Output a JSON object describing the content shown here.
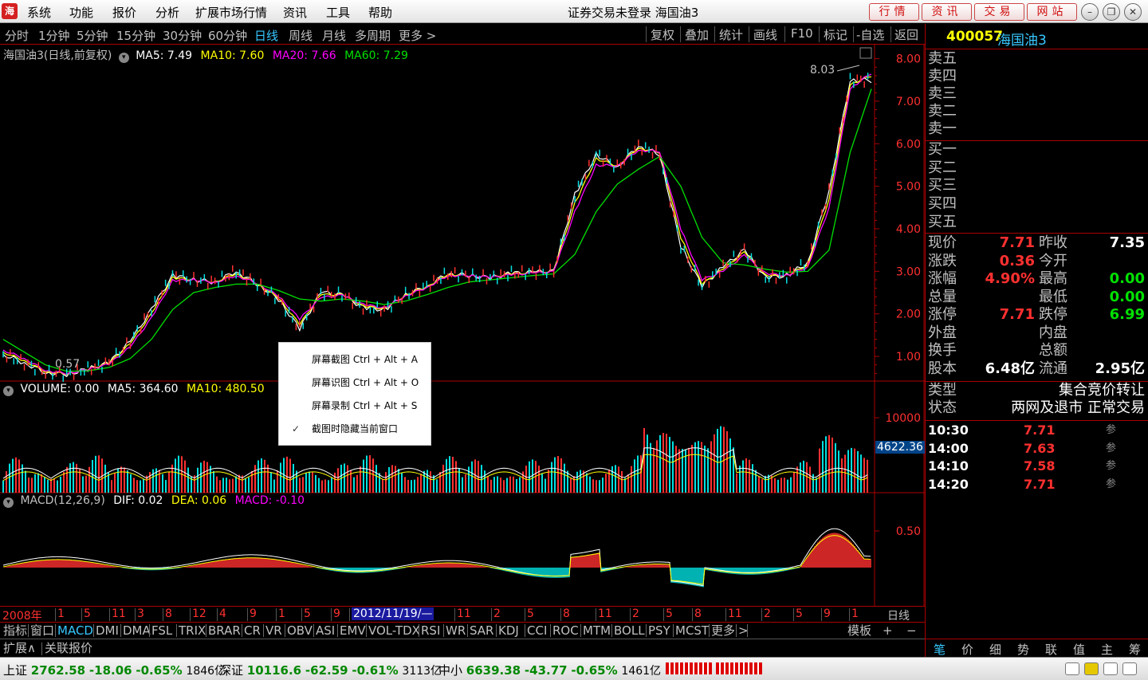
{
  "menubar": {
    "logo": "海",
    "items": [
      "系统",
      "功能",
      "报价",
      "分析",
      "扩展市场行情",
      "资讯",
      "工具",
      "帮助"
    ],
    "title": "证券交易未登录 海国油3",
    "buttons": [
      "行情",
      "资讯",
      "交易",
      "网站"
    ]
  },
  "periods": {
    "items": [
      "分时",
      "1分钟",
      "5分钟",
      "15分钟",
      "30分钟",
      "60分钟",
      "日线",
      "周线",
      "月线",
      "多周期",
      "更多 >"
    ],
    "active": "日线"
  },
  "tools": [
    "复权",
    "叠加",
    "统计",
    "画线",
    "F10",
    "标记",
    "-自选",
    "返回"
  ],
  "stock": {
    "code": "400057",
    "name": "海国油3"
  },
  "main_legend": {
    "title": "海国油3(日线,前复权)",
    "ma5": "MA5: 7.49",
    "ma10": "MA10: 7.60",
    "ma20": "MA20: 7.66",
    "ma60": "MA60: 7.29"
  },
  "vol_legend": {
    "vol": "VOLUME: 0.00",
    "ma5": "MA5: 364.60",
    "ma10": "MA10: 480.50"
  },
  "macd_legend": {
    "name": "MACD(12,26,9)",
    "dif": "DIF: 0.02",
    "dea": "DEA: 0.06",
    "macd": "MACD: -0.10"
  },
  "annotations": {
    "high": "8.03",
    "low": "0.57",
    "vol_tag": "4622.36"
  },
  "colors": {
    "up": "#ff3030",
    "down": "#00e0e0",
    "ma5": "#ffffff",
    "ma10": "#ffff00",
    "ma20": "#ff00ff",
    "ma60": "#00e000",
    "axis": "#ff3030",
    "accent": "#37c8ff"
  },
  "chart_data": [
    {
      "type": "line",
      "title": "海国油3(日线,前复权)",
      "series": [
        {
          "name": "MA5",
          "values": [
            1.05,
            0.85,
            0.62,
            0.58,
            0.7,
            0.85,
            1.35,
            2.1,
            2.9,
            2.8,
            2.75,
            3.0,
            2.7,
            2.35,
            1.65,
            2.5,
            2.45,
            2.15,
            2.1,
            2.45,
            2.65,
            2.95,
            2.9,
            2.85,
            2.95,
            2.98,
            3.0,
            4.8,
            5.75,
            5.45,
            5.95,
            5.75,
            3.6,
            2.65,
            3.1,
            3.5,
            2.85,
            2.9,
            3.2,
            4.9,
            7.5,
            7.49
          ]
        },
        {
          "name": "MA10",
          "values": [
            1.1,
            0.9,
            0.64,
            0.59,
            0.7,
            0.84,
            1.3,
            2.0,
            2.85,
            2.8,
            2.75,
            2.95,
            2.7,
            2.38,
            1.75,
            2.45,
            2.45,
            2.18,
            2.12,
            2.44,
            2.64,
            2.93,
            2.9,
            2.86,
            2.94,
            2.97,
            3.0,
            4.6,
            5.65,
            5.48,
            5.9,
            5.8,
            3.8,
            2.7,
            3.05,
            3.45,
            2.9,
            2.9,
            3.15,
            4.7,
            7.4,
            7.6
          ]
        },
        {
          "name": "MA20",
          "values": [
            1.15,
            0.95,
            0.67,
            0.6,
            0.69,
            0.82,
            1.22,
            1.9,
            2.78,
            2.8,
            2.74,
            2.9,
            2.72,
            2.42,
            1.88,
            2.38,
            2.44,
            2.22,
            2.14,
            2.42,
            2.62,
            2.9,
            2.9,
            2.86,
            2.92,
            2.96,
            2.99,
            4.4,
            5.5,
            5.48,
            5.85,
            5.82,
            4.0,
            2.8,
            3.0,
            3.38,
            2.95,
            2.9,
            3.1,
            4.5,
            7.3,
            7.66
          ]
        },
        {
          "name": "MA60",
          "values": [
            1.4,
            1.1,
            0.8,
            0.65,
            0.66,
            0.74,
            0.95,
            1.4,
            2.1,
            2.5,
            2.62,
            2.7,
            2.7,
            2.55,
            2.35,
            2.3,
            2.35,
            2.3,
            2.22,
            2.3,
            2.45,
            2.62,
            2.75,
            2.8,
            2.85,
            2.9,
            2.94,
            3.4,
            4.4,
            5.05,
            5.4,
            5.7,
            5.0,
            3.8,
            3.2,
            3.15,
            3.05,
            2.98,
            3.0,
            3.5,
            5.8,
            7.29
          ]
        }
      ],
      "ylim": [
        0.57,
        8.03
      ],
      "yticks": [
        "8.00",
        "7.00",
        "6.00",
        "5.00",
        "4.00",
        "3.00",
        "2.00",
        "1.00"
      ]
    },
    {
      "type": "bar",
      "title": "VOLUME",
      "yticks": [
        "10000"
      ],
      "series": [
        {
          "name": "VOLUME",
          "values": [
            0.0
          ]
        },
        {
          "name": "MA5",
          "values": [
            364.6
          ]
        },
        {
          "name": "MA10",
          "values": [
            480.5
          ]
        }
      ]
    },
    {
      "type": "bar",
      "title": "MACD(12,26,9)",
      "yticks": [
        "0.50"
      ],
      "series": [
        {
          "name": "DIF",
          "values": [
            0.02
          ]
        },
        {
          "name": "DEA",
          "values": [
            0.06
          ]
        },
        {
          "name": "MACD",
          "values": [
            -0.1
          ]
        }
      ]
    }
  ],
  "dates": {
    "year": "2008年",
    "labels": [
      "1",
      "5",
      "11",
      "3",
      "8",
      "12",
      "4",
      "9",
      "1",
      "5",
      "9",
      "2012/11/19/—",
      "11",
      "2",
      "5",
      "8",
      "11",
      "2",
      "5",
      "8",
      "11",
      "2",
      "5",
      "9",
      "1"
    ],
    "right": "日线"
  },
  "order_book": {
    "sell": [
      "卖五",
      "卖四",
      "卖三",
      "卖二",
      "卖一"
    ],
    "buy": [
      "买一",
      "买二",
      "买三",
      "买四",
      "买五"
    ]
  },
  "quote": [
    {
      "l1": "现价",
      "v1": "7.71",
      "l2": "昨收",
      "v2": "7.35"
    },
    {
      "l1": "涨跌",
      "v1": "0.36",
      "l2": "今开",
      "v2": ""
    },
    {
      "l1": "涨幅",
      "v1": "4.90%",
      "l2": "最高",
      "v2": "0.00"
    },
    {
      "l1": "总量",
      "v1": "",
      "l2": "最低",
      "v2": "0.00"
    },
    {
      "l1": "涨停",
      "v1": "7.71",
      "l2": "跌停",
      "v2": "6.99"
    },
    {
      "l1": "外盘",
      "v1": "",
      "l2": "内盘",
      "v2": ""
    },
    {
      "l1": "换手",
      "v1": "",
      "l2": "总额",
      "v2": ""
    },
    {
      "l1": "股本",
      "v1": "6.48亿",
      "l2": "流通",
      "v2": "2.95亿"
    }
  ],
  "type_info": {
    "type_label": "类型",
    "type_value": "集合竞价转让",
    "state_label": "状态",
    "state_value": "两网及退市 正常交易"
  },
  "ticks": [
    {
      "time": "10:30",
      "price": "7.71",
      "flag": "参"
    },
    {
      "time": "14:00",
      "price": "7.63",
      "flag": "参"
    },
    {
      "time": "14:10",
      "price": "7.58",
      "flag": "参"
    },
    {
      "time": "14:20",
      "price": "7.71",
      "flag": "参"
    }
  ],
  "context_menu": [
    "屏幕截图 Ctrl + Alt + A",
    "屏幕识图 Ctrl + Alt + O",
    "屏幕录制 Ctrl + Alt + S",
    "截图时隐藏当前窗口"
  ],
  "indicators": {
    "left": [
      "指标",
      "窗口"
    ],
    "items": [
      "MACD",
      "DMI",
      "DMA",
      "FSL",
      "TRIX",
      "BRAR",
      "CR",
      "VR",
      "OBV",
      "ASI",
      "EMV",
      "VOL-TDX",
      "RSI",
      "WR",
      "SAR",
      "KDJ",
      "CCI",
      "ROC",
      "MTM",
      "BOLL",
      "PSY",
      "MCST",
      "更多",
      ">"
    ],
    "active": "MACD",
    "right": [
      "模板",
      "+",
      "−"
    ]
  },
  "extbar": [
    "扩展∧",
    "关联报价"
  ],
  "right_tabs": [
    "笔",
    "价",
    "细",
    "势",
    "联",
    "值",
    "主",
    "筹"
  ],
  "status": [
    {
      "name": "上证",
      "value": "2762.58",
      "change": "-18.06",
      "pct": "-0.65%",
      "amount": "1846亿"
    },
    {
      "name": "深证",
      "value": "10116.6",
      "change": "-62.59",
      "pct": "-0.61%",
      "amount": "3113亿"
    },
    {
      "name": "中小",
      "value": "6639.38",
      "change": "-43.77",
      "pct": "-0.65%",
      "amount": "1461亿"
    }
  ]
}
